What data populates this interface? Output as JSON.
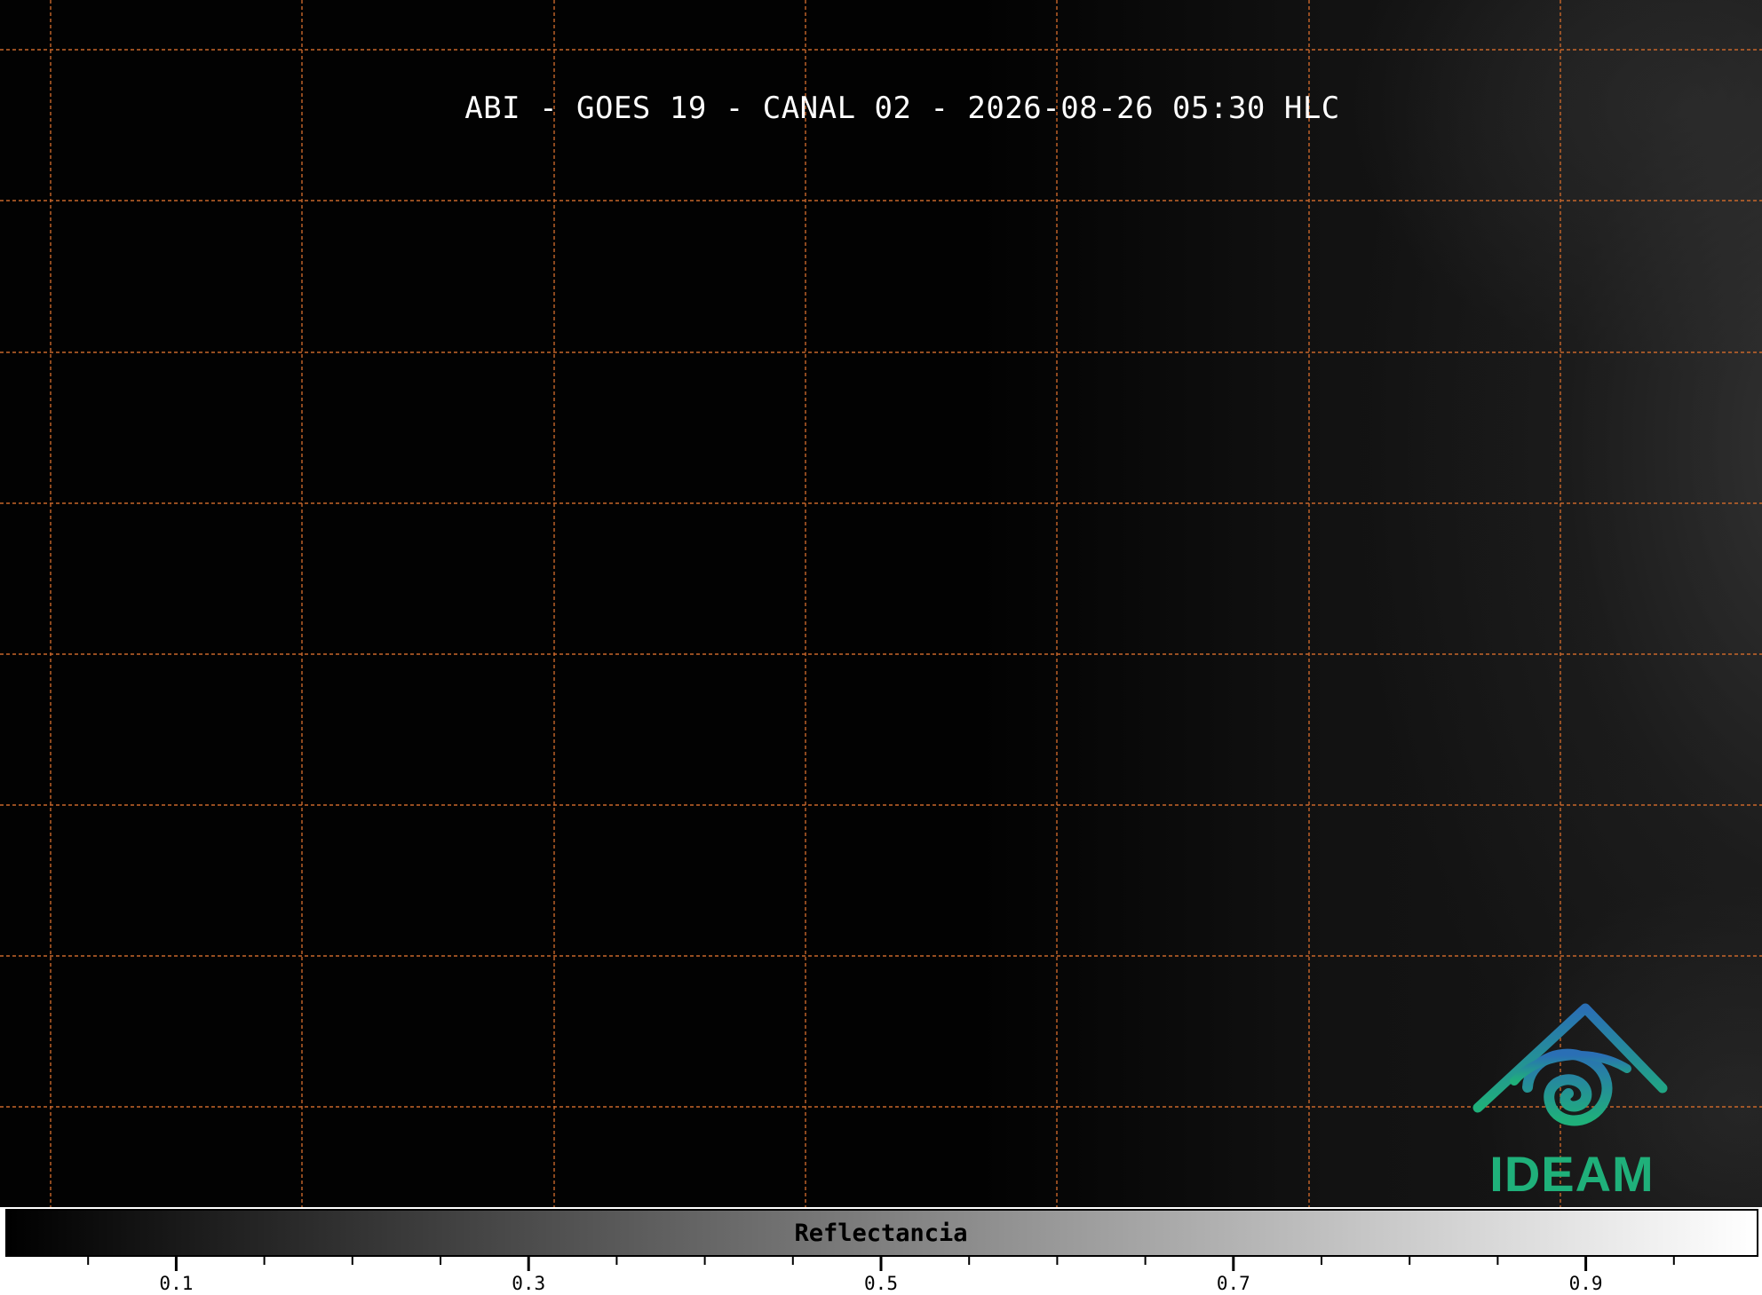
{
  "title": "ABI - GOES 19 - CANAL 02 - 2026-08-26 05:30 HLC",
  "logo": {
    "text": "IDEAM"
  },
  "colors": {
    "grid": "#c8662a",
    "background": "#020202",
    "logo_blue": "#2a6fb5",
    "logo_green": "#1fb07a"
  },
  "colorbar": {
    "label": "Reflectancia",
    "colormap": "gray",
    "range": [
      0.0,
      1.0
    ],
    "major_ticks": [
      0.1,
      0.3,
      0.5,
      0.7,
      0.9
    ],
    "major_tick_labels": [
      "0.1",
      "0.3",
      "0.5",
      "0.7",
      "0.9"
    ],
    "minor_ticks": [
      0.05,
      0.15,
      0.2,
      0.25,
      0.35,
      0.4,
      0.45,
      0.55,
      0.6,
      0.65,
      0.75,
      0.8,
      0.85,
      0.95
    ]
  },
  "grid": {
    "style": "dashed",
    "vertical_lines": 8,
    "horizontal_lines": 8
  }
}
